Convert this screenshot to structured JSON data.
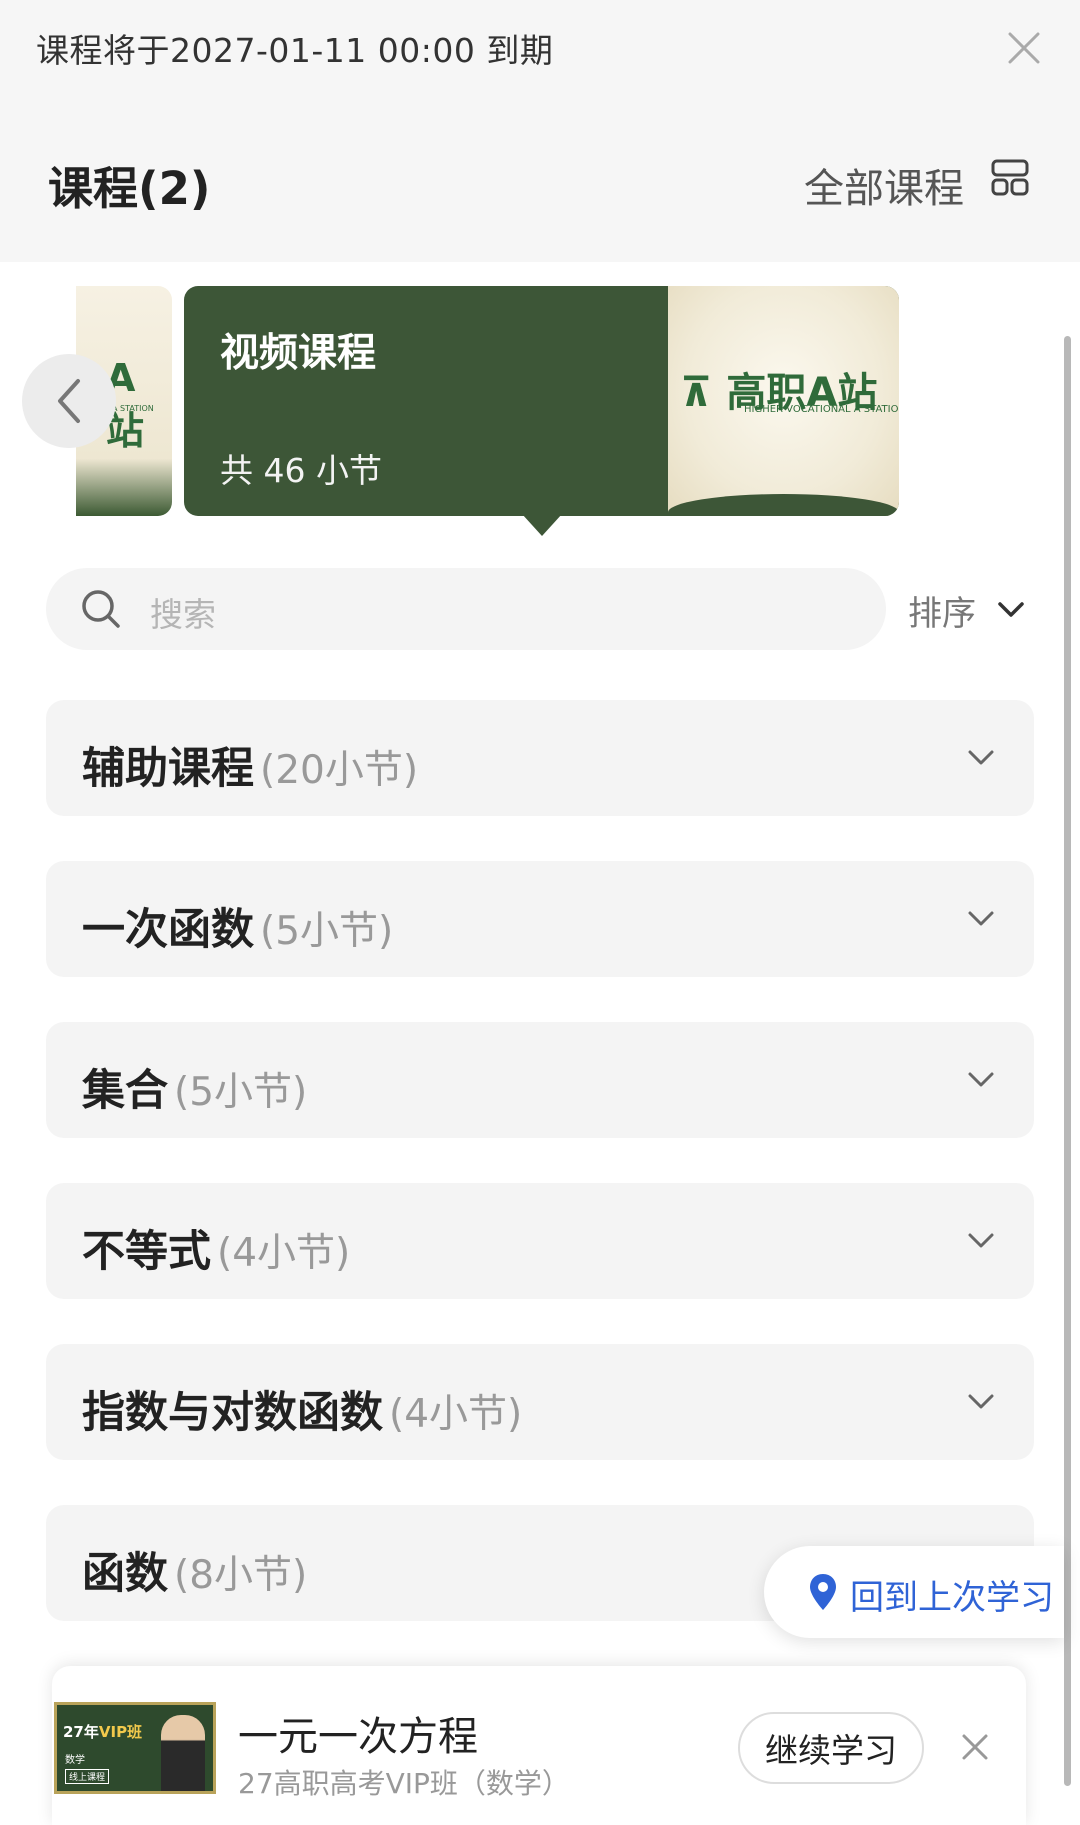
{
  "expiry_notice": "课程将于2027-01-11 00:00 到期",
  "header": {
    "title": "课程(2)",
    "all_courses_label": "全部课程"
  },
  "carousel": {
    "peek_card": {
      "logo_text": "A站",
      "sub_text": "A STATION"
    },
    "active_card": {
      "title": "视频课程",
      "lesson_count": "共 46 小节",
      "thumb_logo": "高职A站",
      "thumb_subtitle": "HIGHER VOCATIONAL A STATION"
    }
  },
  "search": {
    "placeholder": "搜索"
  },
  "sort": {
    "label": "排序"
  },
  "sections": [
    {
      "title": "辅助课程",
      "count": "(20小节)"
    },
    {
      "title": "一次函数",
      "count": "(5小节)"
    },
    {
      "title": "集合",
      "count": "(5小节)"
    },
    {
      "title": "不等式",
      "count": "(4小节)"
    },
    {
      "title": "指数与对数函数",
      "count": "(4小节)"
    },
    {
      "title": "函数",
      "count": "(8小节)"
    }
  ],
  "return_button": {
    "label": "回到上次学习"
  },
  "mini_player": {
    "thumb_badge_year": "27年",
    "thumb_badge_vip": "VIP班",
    "thumb_subject": "数学",
    "thumb_tag": "线上课程",
    "title": "一元一次方程",
    "subtitle": "27高职高考VIP班（数学）",
    "continue_label": "继续学习"
  },
  "colors": {
    "card_green": "#3d5637",
    "logo_green": "#2f6b3a",
    "link_blue": "#2f63d6",
    "panel_grey": "#f4f4f4"
  }
}
